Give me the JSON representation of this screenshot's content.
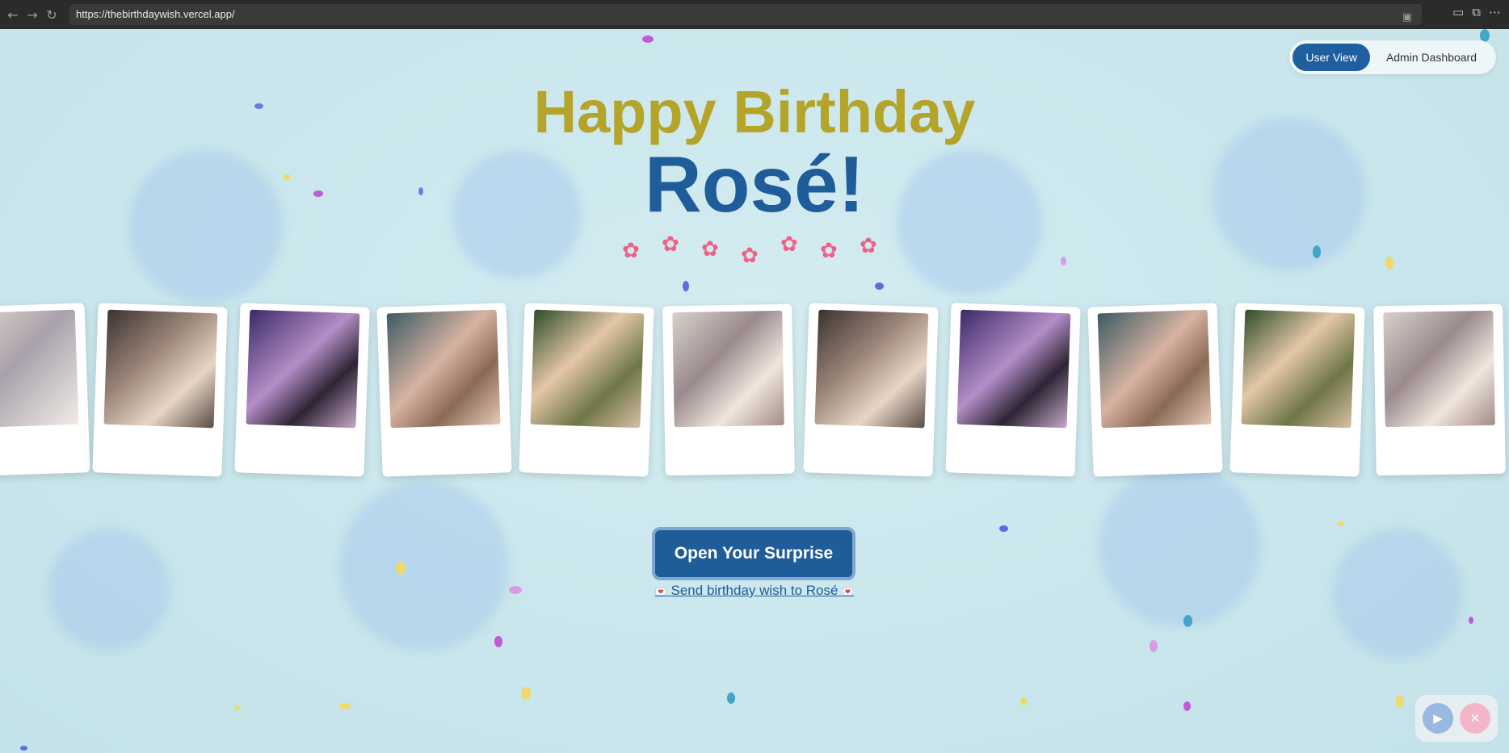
{
  "browser": {
    "url": "https://thebirthdaywish.vercel.app/",
    "back_icon": "back-arrow-icon",
    "forward_icon": "forward-arrow-icon",
    "reload_icon": "reload-icon"
  },
  "view_toggle": {
    "user_view": "User View",
    "admin_dashboard": "Admin Dashboard"
  },
  "greeting": {
    "line1": "Happy Birthday",
    "line2": "Rosé!"
  },
  "decor": {
    "flower_icon": "cherry-blossom-icon",
    "flower_count": 7
  },
  "photo_strip": {
    "photos": [
      {
        "alt": "group selfie 1"
      },
      {
        "alt": "group selfie 2"
      },
      {
        "alt": "group selfie 3"
      },
      {
        "alt": "group selfie 4"
      },
      {
        "alt": "group selfie 5"
      },
      {
        "alt": "group selfie 6"
      },
      {
        "alt": "group selfie 7"
      },
      {
        "alt": "group selfie 8"
      },
      {
        "alt": "group selfie 9"
      },
      {
        "alt": "group selfie 10"
      },
      {
        "alt": "group selfie 11"
      }
    ]
  },
  "actions": {
    "open_surprise": "Open Your Surprise",
    "send_wish": "Send birthday wish to Rosé"
  },
  "media": {
    "play_icon": "play-icon",
    "mute_icon": "mute-icon"
  },
  "colors": {
    "accent_blue": "#1e5c9a",
    "title_gold": "#b4a42a",
    "flower_pink": "#ef5f86",
    "background": "#cfe9ee"
  }
}
